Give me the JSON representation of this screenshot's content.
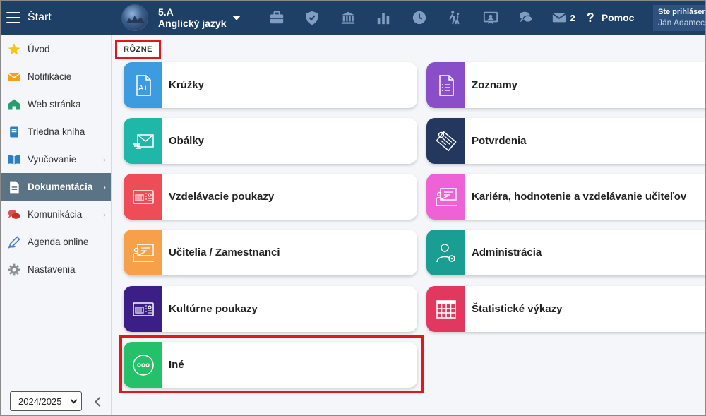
{
  "topbar": {
    "menu_label": "Štart",
    "class_name": "5.A",
    "subject": "Anglický jazyk",
    "icons": [
      "briefcase-icon",
      "shield-check-icon",
      "bank-icon",
      "bar-chart-icon",
      "clock-icon",
      "walking-icon",
      "board-icon",
      "chat-icon",
      "mail-icon"
    ],
    "message_count": "2",
    "help_label": "Pomoc",
    "user_status": "Ste prihlásen",
    "user_name": "Ján Adamec"
  },
  "sidebar": {
    "items": [
      {
        "label": "Úvod",
        "icon": "star-icon",
        "color": "#f5c518"
      },
      {
        "label": "Notifikácie",
        "icon": "envelope-icon",
        "color": "#f0a020"
      },
      {
        "label": "Web stránka",
        "icon": "house-icon",
        "color": "#2a9d6f"
      },
      {
        "label": "Triedna kniha",
        "icon": "book-icon",
        "color": "#2d7fc1"
      },
      {
        "label": "Vyučovanie",
        "icon": "open-book-icon",
        "color": "#2d7fc1"
      },
      {
        "label": "Dokumentácia",
        "icon": "document-icon",
        "color": "#ffffff"
      },
      {
        "label": "Komunikácia",
        "icon": "speech-bubbles-icon",
        "color": "#d9534f"
      },
      {
        "label": "Agenda online",
        "icon": "pen-icon",
        "color": "#4a7ec1"
      },
      {
        "label": "Nastavenia",
        "icon": "gear-icon",
        "color": "#8a8f96"
      }
    ],
    "year": "2024/2025"
  },
  "main": {
    "section_label": "RÔZNE",
    "cards": [
      {
        "label": "Krúžky",
        "icon": "a-plus-document-icon",
        "color": "#3d9be0"
      },
      {
        "label": "Zoznamy",
        "icon": "list-document-icon",
        "color": "#8a4fc8"
      },
      {
        "label": "Obálky",
        "icon": "envelope-lines-icon",
        "color": "#1fb8a8"
      },
      {
        "label": "Potvrdenia",
        "icon": "certificate-ribbon-icon",
        "color": "#24375e"
      },
      {
        "label": "Vzdelávacie poukazy",
        "icon": "voucher-icon",
        "color": "#ee4c56"
      },
      {
        "label": "Kariéra, hodnotenie a vzdelávanie učiteľov",
        "icon": "teacher-board-icon",
        "color": "#ee62d6"
      },
      {
        "label": "Učitelia / Zamestnanci",
        "icon": "teacher-board-icon",
        "color": "#f7a04a"
      },
      {
        "label": "Administrácia",
        "icon": "admin-user-icon",
        "color": "#1a9e93"
      },
      {
        "label": "Kultúrne poukazy",
        "icon": "voucher-icon",
        "color": "#3b1f86"
      },
      {
        "label": "Štatistické výkazy",
        "icon": "table-grid-icon",
        "color": "#e2385f"
      },
      {
        "label": "Iné",
        "icon": "more-dots-icon",
        "color": "#25c06a"
      }
    ]
  }
}
